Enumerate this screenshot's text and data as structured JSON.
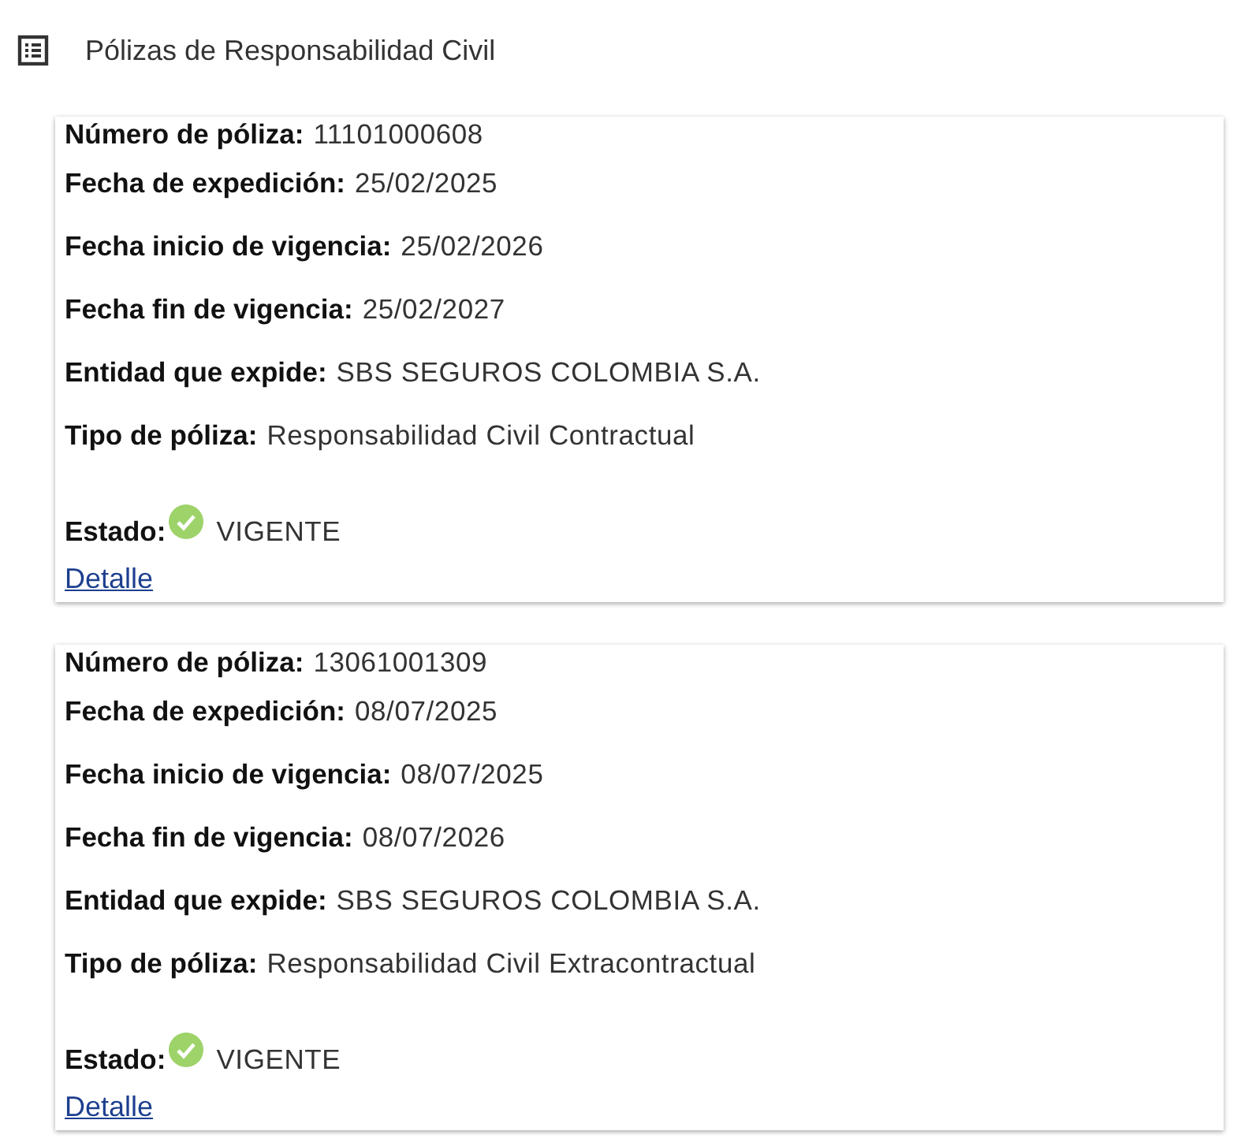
{
  "header": {
    "title": "Pólizas de Responsabilidad Civil"
  },
  "policies": [
    {
      "fields": [
        {
          "label": "Número de póliza:",
          "value": "11101000608"
        },
        {
          "label": "Fecha de expedición:",
          "value": "25/02/2025"
        },
        {
          "label": "Fecha inicio de vigencia:",
          "value": "25/02/2026"
        },
        {
          "label": "Fecha fin de vigencia:",
          "value": "25/02/2027"
        },
        {
          "label": "Entidad que expide:",
          "value": "SBS SEGUROS COLOMBIA S.A."
        },
        {
          "label": "Tipo de póliza:",
          "value": "Responsabilidad Civil Contractual"
        }
      ],
      "status": {
        "label": "Estado:",
        "value": "VIGENTE",
        "valid": true
      },
      "link": "Detalle"
    },
    {
      "fields": [
        {
          "label": "Número de póliza:",
          "value": "13061001309"
        },
        {
          "label": "Fecha de expedición:",
          "value": "08/07/2025"
        },
        {
          "label": "Fecha inicio de vigencia:",
          "value": "08/07/2025"
        },
        {
          "label": "Fecha fin de vigencia:",
          "value": "08/07/2026"
        },
        {
          "label": "Entidad que expide:",
          "value": "SBS SEGUROS COLOMBIA S.A."
        },
        {
          "label": "Tipo de póliza:",
          "value": "Responsabilidad Civil Extracontractual"
        }
      ],
      "status": {
        "label": "Estado:",
        "value": "VIGENTE",
        "valid": true
      },
      "link": "Detalle"
    }
  ]
}
